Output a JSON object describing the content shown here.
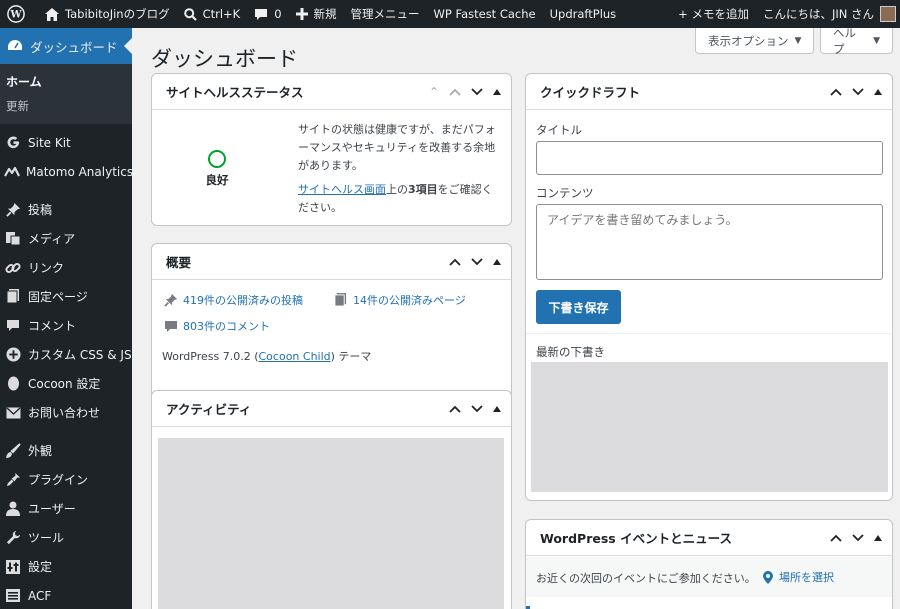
{
  "adminbar": {
    "site_name": "TabibitoJinのブログ",
    "search_shortcut": "Ctrl+K",
    "comments_count": "0",
    "new_label": "新規",
    "manage_menu": "管理メニュー",
    "fastest_cache": "WP Fastest Cache",
    "updraft": "UpdraftPlus",
    "add_memo": "+ メモを追加",
    "greeting": "こんにちは、JIN さん"
  },
  "sidebar": {
    "current": "ダッシュボード",
    "sub_home": "ホーム",
    "sub_updates": "更新",
    "items": [
      {
        "label": "Site Kit",
        "icon": "g-icon"
      },
      {
        "label": "Matomo Analytics",
        "icon": "matomo-icon"
      },
      {
        "label": "投稿",
        "icon": "pin-icon"
      },
      {
        "label": "メディア",
        "icon": "media-icon"
      },
      {
        "label": "リンク",
        "icon": "link-icon"
      },
      {
        "label": "固定ページ",
        "icon": "page-icon"
      },
      {
        "label": "コメント",
        "icon": "comment-icon"
      },
      {
        "label": "カスタム CSS & JS",
        "icon": "plus-circle-icon"
      },
      {
        "label": "Cocoon 設定",
        "icon": "cocoon-icon"
      },
      {
        "label": "お問い合わせ",
        "icon": "mail-icon"
      },
      {
        "label": "外観",
        "icon": "brush-icon"
      },
      {
        "label": "プラグイン",
        "icon": "plugin-icon"
      },
      {
        "label": "ユーザー",
        "icon": "user-icon"
      },
      {
        "label": "ツール",
        "icon": "wrench-icon"
      },
      {
        "label": "設定",
        "icon": "settings-icon"
      },
      {
        "label": "ACF",
        "icon": "acf-icon"
      }
    ]
  },
  "main": {
    "title": "ダッシュボード",
    "screen_options": "表示オプション",
    "help": "ヘルプ"
  },
  "site_health": {
    "title": "サイトヘルスステータス",
    "status": "良好",
    "message": "サイトの状態は健康ですが、まだパフォーマンスやセキュリティを改善する余地があります。",
    "link": "サイトヘルス画面",
    "msg2_a": "上の",
    "msg2_bold": "3項目",
    "msg2_b": "をご確認ください。"
  },
  "glance": {
    "title": "概要",
    "posts": "419件の公開済みの投稿",
    "pages": "14件の公開済みページ",
    "comments": "803件のコメント",
    "version": "WordPress 7.0.2 (",
    "theme": "Cocoon Child",
    "theme_suffix": ") テーマ"
  },
  "activity": {
    "title": "アクティビティ"
  },
  "quick_draft": {
    "title": "クイックドラフト",
    "title_label": "タイトル",
    "content_label": "コンテンツ",
    "content_placeholder": "アイデアを書き留めてみましょう。",
    "save": "下書き保存",
    "recent": "最新の下書き"
  },
  "events": {
    "title": "WordPress イベントとニュース",
    "text": "お近くの次回のイベントにご参加ください。",
    "location": "場所を選択"
  }
}
